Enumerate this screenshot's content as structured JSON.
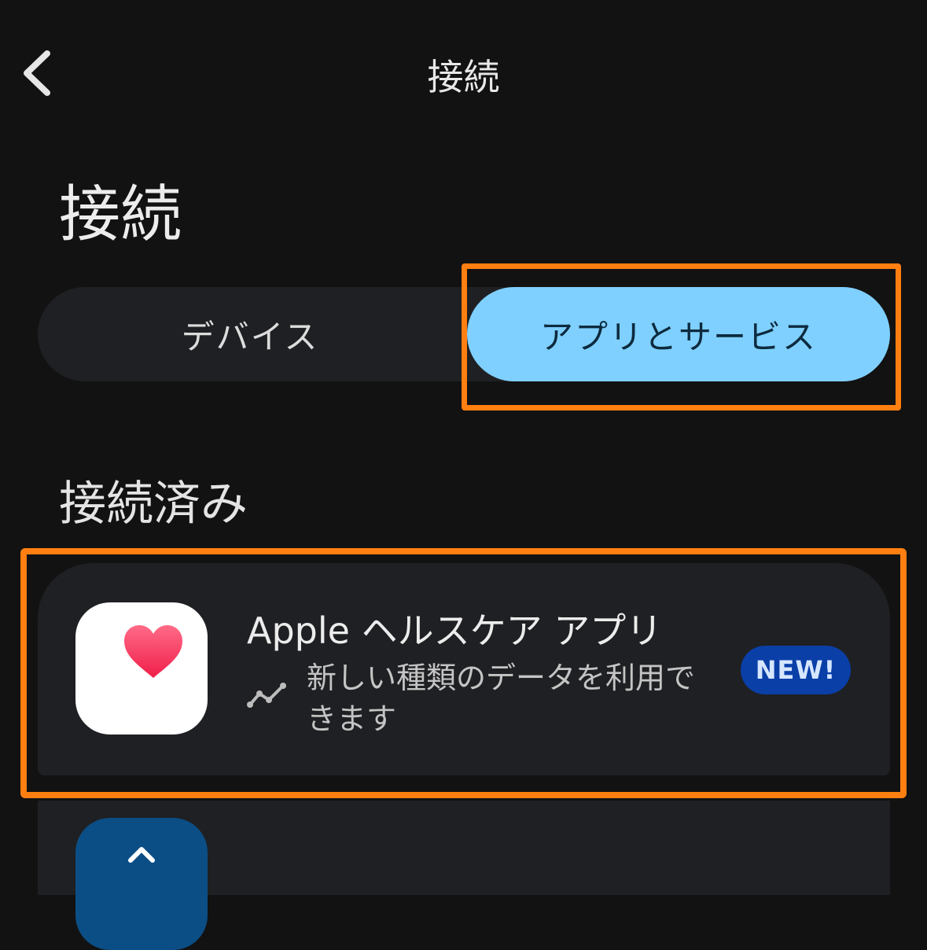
{
  "nav": {
    "title": "接続",
    "back_icon": "chevron-left-icon"
  },
  "page": {
    "title": "接続"
  },
  "tabs": [
    {
      "label": "デバイス",
      "selected": false
    },
    {
      "label": "アプリとサービス",
      "selected": true
    }
  ],
  "section": {
    "title": "接続済み"
  },
  "connected_apps": [
    {
      "name": "Apple ヘルスケア アプリ",
      "icon": "heart-icon",
      "status_icon": "trend-line-icon",
      "description": "新しい種類のデータを利用できます",
      "badge": "NEW!"
    }
  ],
  "colors": {
    "background": "#121212",
    "surface": "#1f2023",
    "selected_tab": "#7fd0ff",
    "highlight": "#ff7f10",
    "badge": "#0a3fa8",
    "heart": "#f0335a"
  }
}
